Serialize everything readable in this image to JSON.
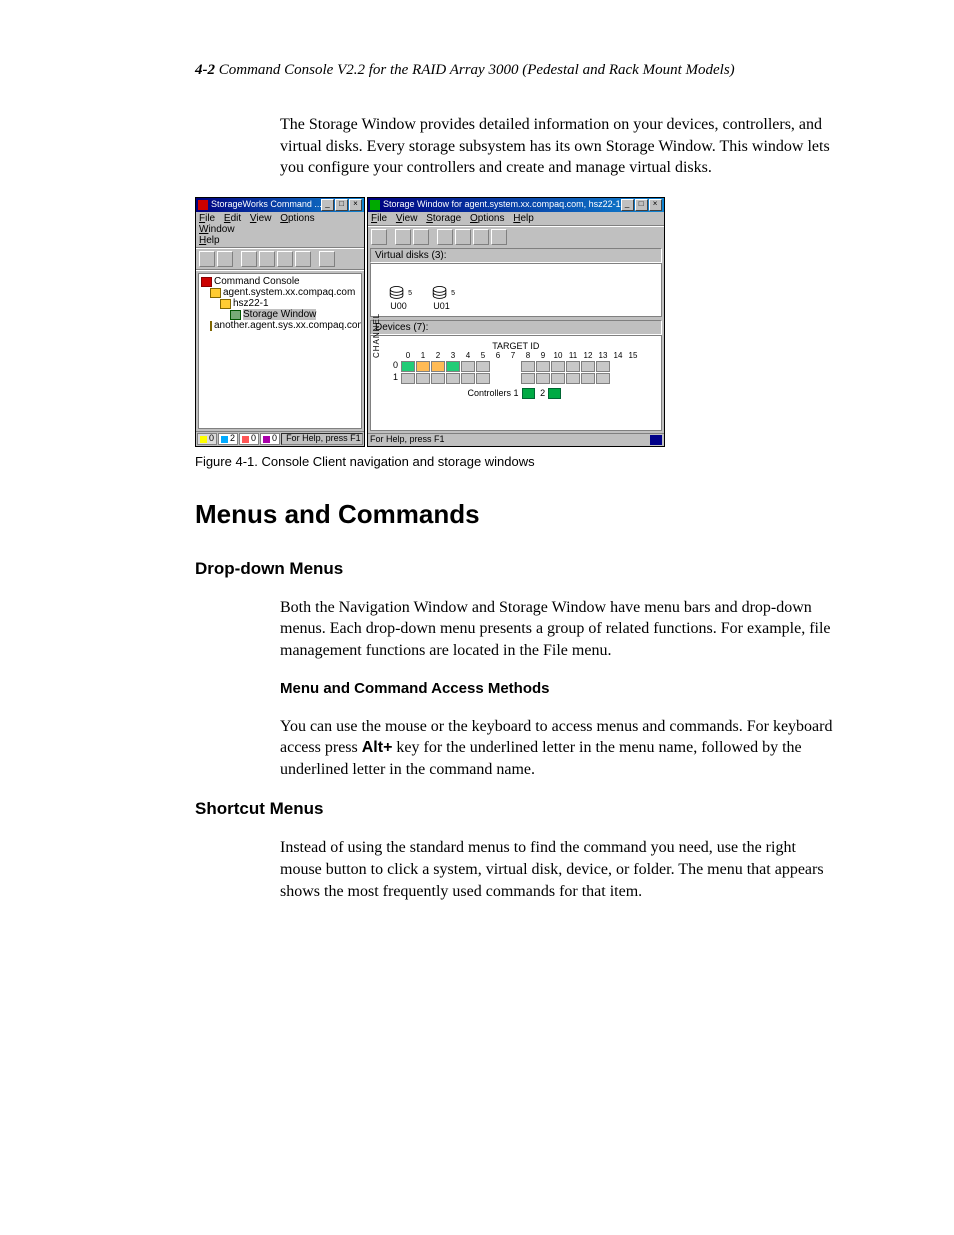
{
  "header": {
    "page": "4-2",
    "title": "Command Console V2.2 for the RAID Array 3000 (Pedestal and Rack Mount Models)"
  },
  "intro": "The Storage Window provides detailed information on your devices, controllers, and virtual disks. Every storage subsystem has its own Storage Window. This window lets you configure your controllers and create and manage virtual disks.",
  "figure": {
    "caption": "Figure 4-1.  Console Client navigation and storage windows",
    "left": {
      "title": "StorageWorks Command ...",
      "menus": [
        "File",
        "Edit",
        "View",
        "Options",
        "Window",
        "Help"
      ],
      "tree": {
        "root": "Command Console",
        "n1": "agent.system.xx.compaq.com",
        "n2": "hsz22-1",
        "n3": "Storage Window",
        "n4": "another.agent.sys.xx.compaq.com"
      },
      "status": {
        "a": "0",
        "b": "2",
        "c": "0",
        "d": "0",
        "help": "For Help, press F1"
      }
    },
    "right": {
      "title": "Storage Window for agent.system.xx.compaq.com, hsz22-1",
      "menus": [
        "File",
        "View",
        "Storage",
        "Options",
        "Help"
      ],
      "vd_label": "Virtual disks (3):",
      "vd": [
        {
          "name": "U00",
          "badge": "5"
        },
        {
          "name": "U01",
          "badge": "5"
        }
      ],
      "dev_label": "Devices (7):",
      "target": "TARGET ID",
      "channel": "CHANNEL",
      "cols": [
        "0",
        "1",
        "2",
        "3",
        "4",
        "5",
        "6",
        "7",
        "8",
        "9",
        "10",
        "11",
        "12",
        "13",
        "14",
        "15"
      ],
      "controllers": "Controllers 1",
      "controllers2": "2",
      "help": "For Help, press F1"
    }
  },
  "h1": "Menus and Commands",
  "s1": {
    "title": "Drop-down Menus",
    "p": "Both the Navigation Window and Storage Window have menu bars and drop-down menus. Each drop-down menu presents a group of related functions. For example, file management functions are located in the File menu.",
    "sub_title": "Menu and Command Access Methods",
    "sub_p_a": "You can use the mouse or the keyboard to access menus and commands. For keyboard access press ",
    "sub_kbd": "Alt+",
    "sub_p_b": " key for the underlined letter in the menu name, followed by the underlined letter in the command name."
  },
  "s2": {
    "title": "Shortcut Menus",
    "p": "Instead of using the standard menus to find the command you need, use the right mouse button to click a system, virtual disk, device, or folder. The menu that appears shows the most frequently used commands for that item."
  }
}
